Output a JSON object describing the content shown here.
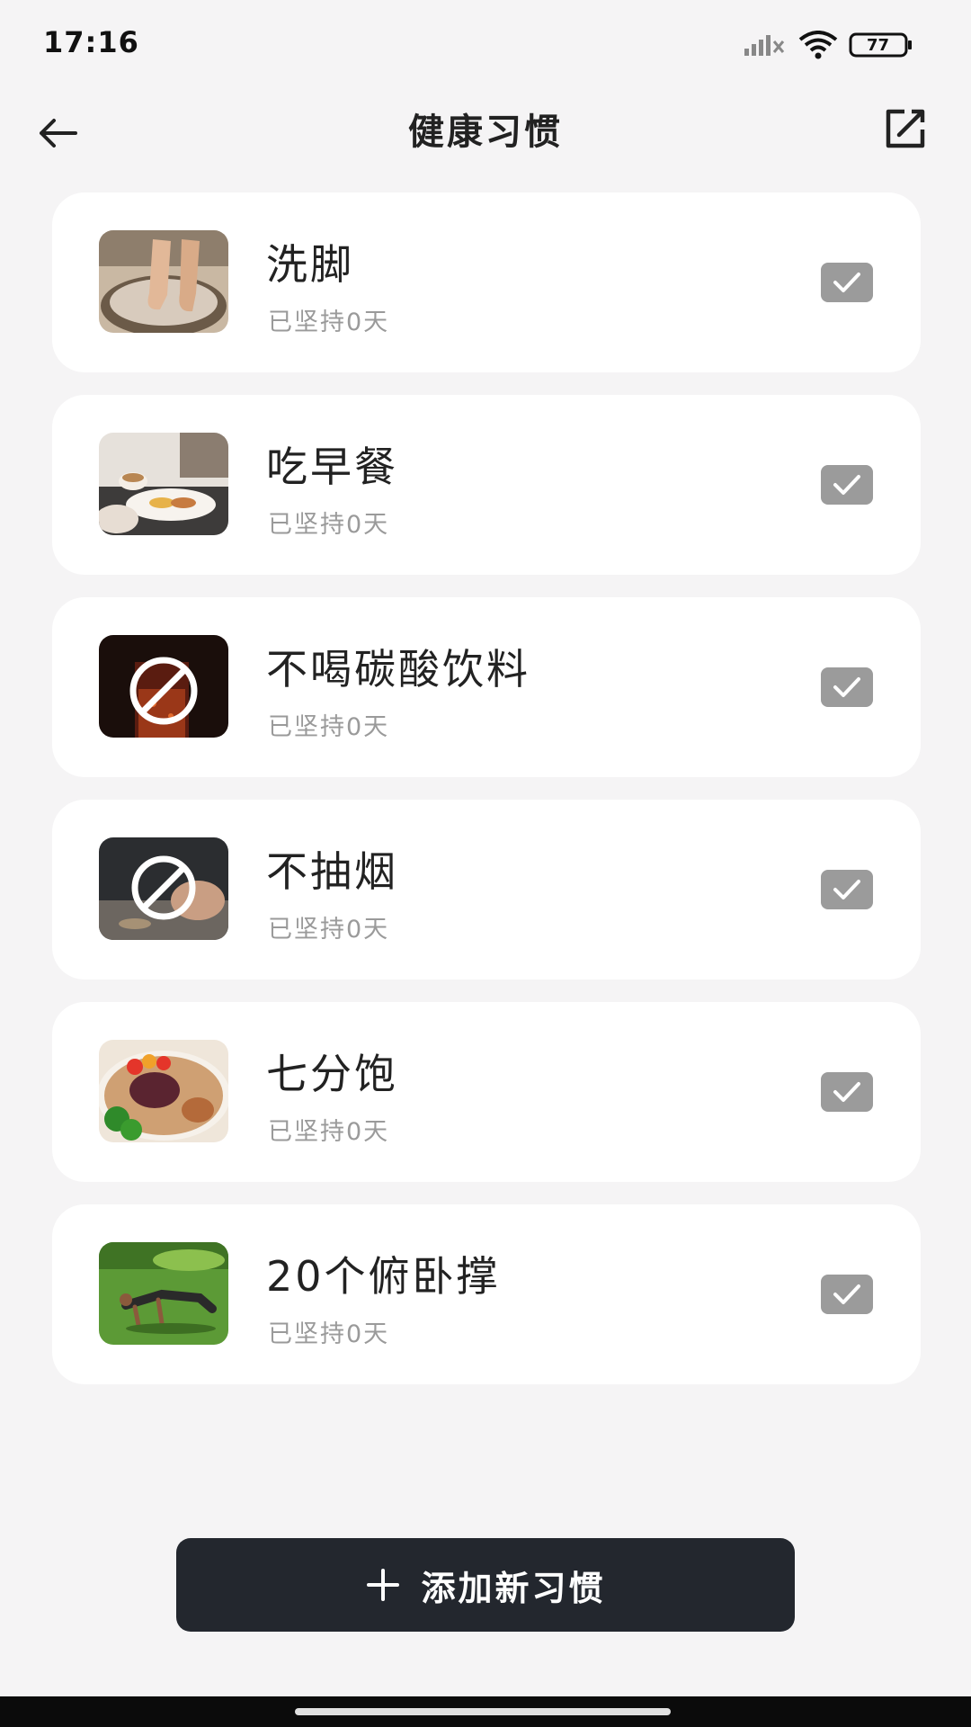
{
  "status_bar": {
    "time": "17:16",
    "battery": "77",
    "icons": [
      "signal-icon",
      "wifi-icon",
      "battery-icon"
    ]
  },
  "header": {
    "title": "健康习惯",
    "back_icon": "arrow-left-icon",
    "edit_icon": "edit-icon"
  },
  "habits": [
    {
      "name": "洗脚",
      "days": "已坚持0天",
      "image": "foot-soak-photo",
      "checked": true
    },
    {
      "name": "吃早餐",
      "days": "已坚持0天",
      "image": "breakfast-photo",
      "checked": true
    },
    {
      "name": "不喝碳酸饮料",
      "days": "已坚持0天",
      "image": "no-soda-photo",
      "checked": true
    },
    {
      "name": "不抽烟",
      "days": "已坚持0天",
      "image": "no-smoking-photo",
      "checked": true
    },
    {
      "name": "七分饱",
      "days": "已坚持0天",
      "image": "salad-plate-photo",
      "checked": true
    },
    {
      "name": "20个俯卧撑",
      "days": "已坚持0天",
      "image": "pushup-photo",
      "checked": true
    }
  ],
  "add_button": {
    "label": "添加新习惯",
    "icon": "plus-icon"
  },
  "colors": {
    "background": "#f5f4f5",
    "card": "#ffffff",
    "check": "#9b9b9b",
    "button": "#23272e"
  }
}
